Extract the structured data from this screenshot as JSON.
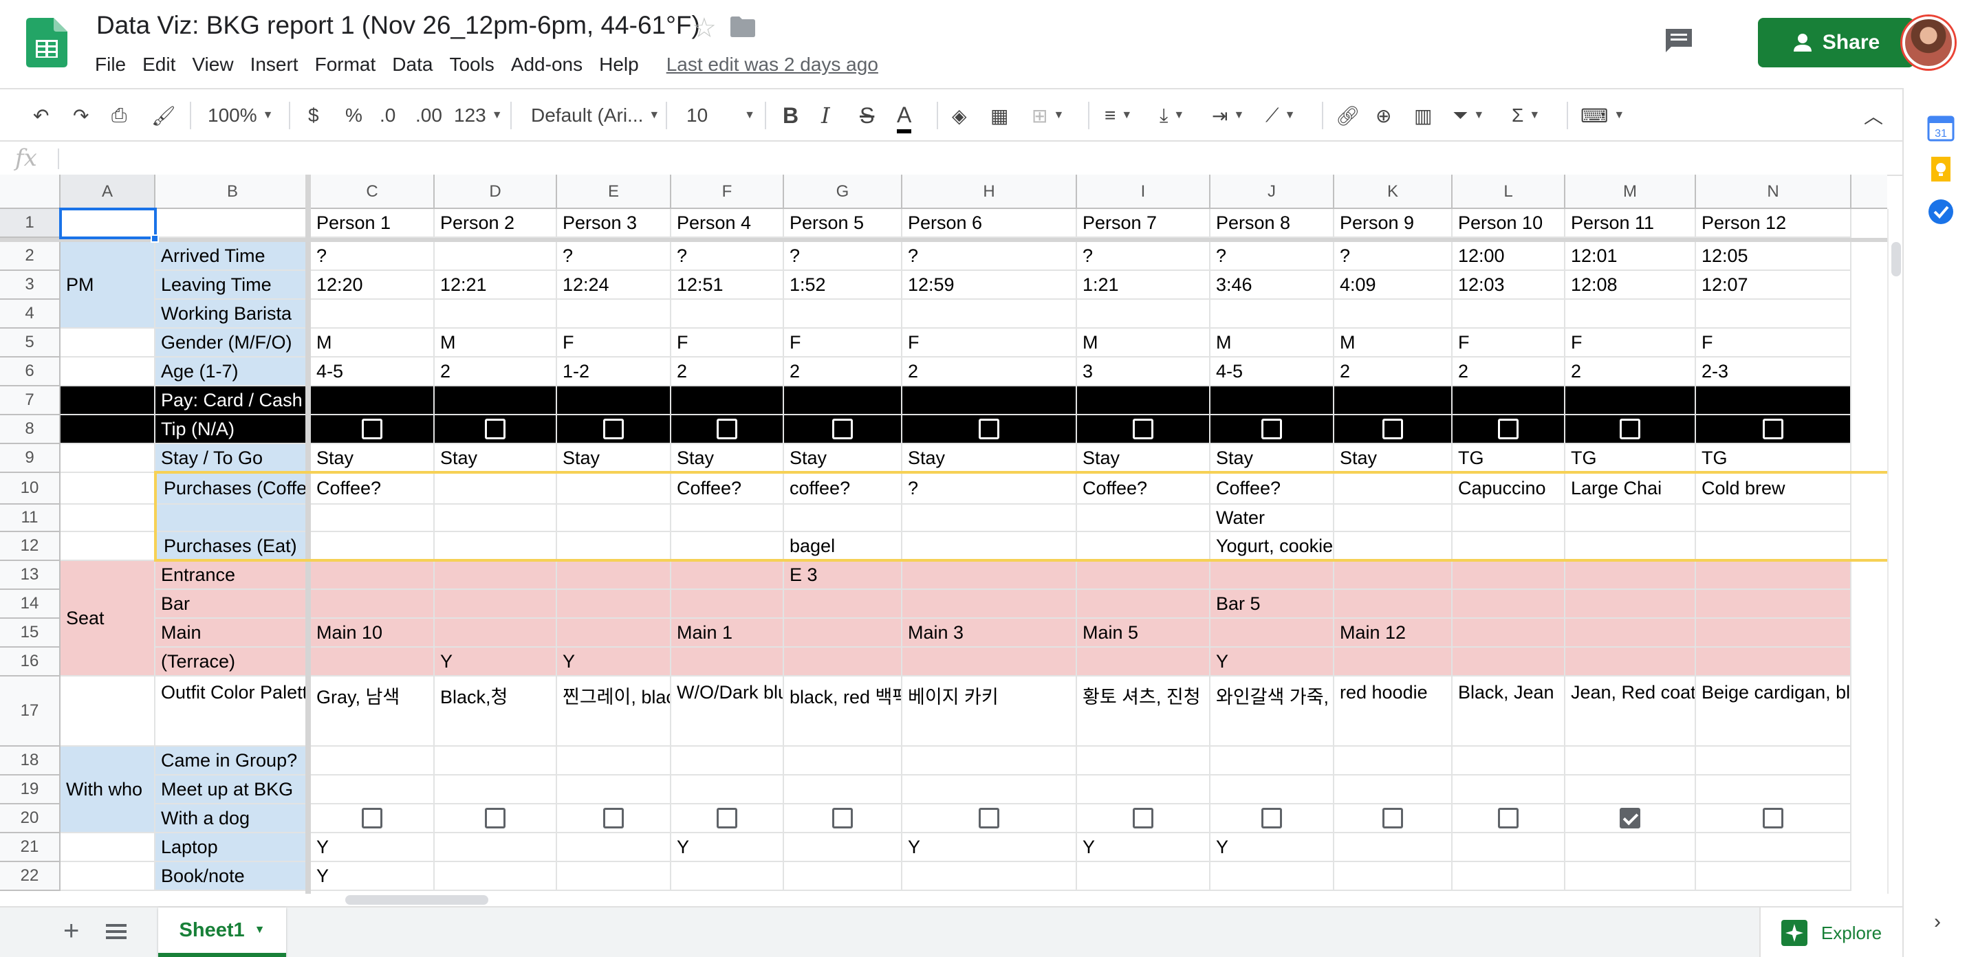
{
  "app": {
    "title": "Data Viz: BKG report 1 (Nov 26_12pm-6pm, 44-61°F)",
    "menu": [
      "File",
      "Edit",
      "View",
      "Insert",
      "Format",
      "Data",
      "Tools",
      "Add-ons",
      "Help"
    ],
    "last_edit": "Last edit was 2 days ago",
    "share_label": "Share"
  },
  "toolbar": {
    "zoom": "100%",
    "currency": "$",
    "percent": "%",
    "dec_less": ".0",
    "dec_more": ".00",
    "more_formats": "123",
    "font": "Default (Ari...",
    "font_size": "10",
    "bold": "B",
    "italic": "I",
    "strike": "S",
    "text_color": "A"
  },
  "formula_bar": {
    "fx": "fx",
    "value": ""
  },
  "columns": [
    {
      "letter": "A"
    },
    {
      "letter": "B"
    },
    {
      "letter": "C"
    },
    {
      "letter": "D"
    },
    {
      "letter": "E"
    },
    {
      "letter": "F"
    },
    {
      "letter": "G"
    },
    {
      "letter": "H"
    },
    {
      "letter": "I"
    },
    {
      "letter": "J"
    },
    {
      "letter": "K"
    },
    {
      "letter": "L"
    },
    {
      "letter": "M"
    },
    {
      "letter": "N"
    }
  ],
  "rows": [
    "1",
    "2",
    "3",
    "4",
    "5",
    "6",
    "7",
    "8",
    "9",
    "10",
    "11",
    "12",
    "13",
    "14",
    "15",
    "16",
    "17",
    "18",
    "19",
    "20",
    "21",
    "22"
  ],
  "colors": {
    "blue_label": "#cfe2f3",
    "pink_seat": "#f4cccc",
    "black_band": "#000000",
    "yellow_border": "#f6d155",
    "selection": "#1a73e8",
    "brand_green": "#188038"
  },
  "sheet": {
    "group_labels": {
      "pm": "PM",
      "seat": "Seat",
      "with_who": "With who"
    },
    "row_labels": {
      "2": "Arrived Time",
      "3": "Leaving Time",
      "4": "Working Barista",
      "5": "Gender (M/F/O)",
      "6": "Age (1-7)",
      "7": "Pay: Card / Cash (N/A)",
      "8": "Tip (N/A)",
      "9": "Stay / To Go",
      "10": "Purchases (Coffee)",
      "11": "",
      "12": "Purchases (Eat)",
      "13": "Entrance",
      "14": "Bar",
      "15": "Main",
      "16": "(Terrace)",
      "17": "Outfit Color Palette",
      "18": "Came in Group?",
      "19": "Meet up at BKG",
      "20": "With a dog",
      "21": "Laptop",
      "22": "Book/note"
    },
    "persons": [
      "Person 1",
      "Person 2",
      "Person 3",
      "Person 4",
      "Person 5",
      "Person 6",
      "Person 7",
      "Person 8",
      "Person 9",
      "Person 10",
      "Person 11",
      "Person 12"
    ],
    "data": {
      "2": [
        "?",
        "",
        "?",
        "?",
        "?",
        "?",
        "?",
        "?",
        "?",
        "12:00",
        "12:01",
        "12:05"
      ],
      "3": [
        "12:20",
        "12:21",
        "12:24",
        "12:51",
        "1:52",
        "12:59",
        "1:21",
        "3:46",
        "4:09",
        "12:03",
        "12:08",
        "12:07"
      ],
      "4": [
        "",
        "",
        "",
        "",
        "",
        "",
        "",
        "",
        "",
        "",
        "",
        ""
      ],
      "5": [
        "M",
        "M",
        "F",
        "F",
        "F",
        "F",
        "M",
        "M",
        "M",
        "F",
        "F",
        "F"
      ],
      "6": [
        "4-5",
        "2",
        "1-2",
        "2",
        "2",
        "2",
        "3",
        "4-5",
        "2",
        "2",
        "2",
        "2-3"
      ],
      "9": [
        "Stay",
        "Stay",
        "Stay",
        "Stay",
        "Stay",
        "Stay",
        "Stay",
        "Stay",
        "Stay",
        "TG",
        "TG",
        "TG"
      ],
      "10": [
        "Coffee?",
        "",
        "",
        "Coffee?",
        "coffee?",
        "?",
        "Coffee?",
        "Coffee?",
        "",
        "Capuccino",
        "Large Chai",
        "Cold brew"
      ],
      "11": [
        "",
        "",
        "",
        "",
        "",
        "",
        "",
        "Water",
        "",
        "",
        "",
        ""
      ],
      "12": [
        "",
        "",
        "",
        "",
        "bagel",
        "",
        "",
        "Yogurt, cookie",
        "",
        "",
        "",
        ""
      ],
      "13": [
        "",
        "",
        "",
        "",
        "E 3",
        "",
        "",
        "",
        "",
        "",
        "",
        ""
      ],
      "14": [
        "",
        "",
        "",
        "",
        "",
        "",
        "",
        "Bar 5",
        "",
        "",
        "",
        ""
      ],
      "15": [
        "Main 10",
        "",
        "",
        "Main 1",
        "",
        "Main 3",
        "Main 5",
        "",
        "Main 12",
        "",
        "",
        ""
      ],
      "16": [
        "",
        "Y",
        "Y",
        "",
        "",
        "",
        "",
        "Y",
        "",
        "",
        "",
        ""
      ],
      "17": [
        "Gray, 남색",
        "Black,청",
        "찐그레이, black",
        "W/O/Dark blue",
        "black, red 백팩",
        "베이지 카키",
        "황토 셔츠, 진청",
        "와인갈색 가죽, g",
        "red hoodie",
        "Black, Jean",
        "Jean, Red coat",
        "Beige cardigan, bla"
      ],
      "18": [
        "",
        "",
        "",
        "",
        "",
        "",
        "",
        "",
        "",
        "",
        "",
        ""
      ],
      "19": [
        "",
        "",
        "",
        "",
        "",
        "",
        "",
        "",
        "",
        "",
        "",
        ""
      ],
      "21": [
        "Y",
        "",
        "",
        "Y",
        "",
        "Y",
        "Y",
        "Y",
        "",
        "",
        "",
        ""
      ],
      "22": [
        "Y",
        "",
        "",
        "",
        "",
        "",
        "",
        "",
        "",
        "",
        "",
        ""
      ]
    },
    "checkbox_rows": {
      "8": [
        false,
        false,
        false,
        false,
        false,
        false,
        false,
        false,
        false,
        false,
        false,
        false
      ],
      "20": [
        false,
        false,
        false,
        false,
        false,
        false,
        false,
        false,
        false,
        false,
        true,
        false
      ]
    }
  },
  "bottom": {
    "add_sheet": "+",
    "sheet_tab": "Sheet1",
    "explore": "Explore"
  }
}
